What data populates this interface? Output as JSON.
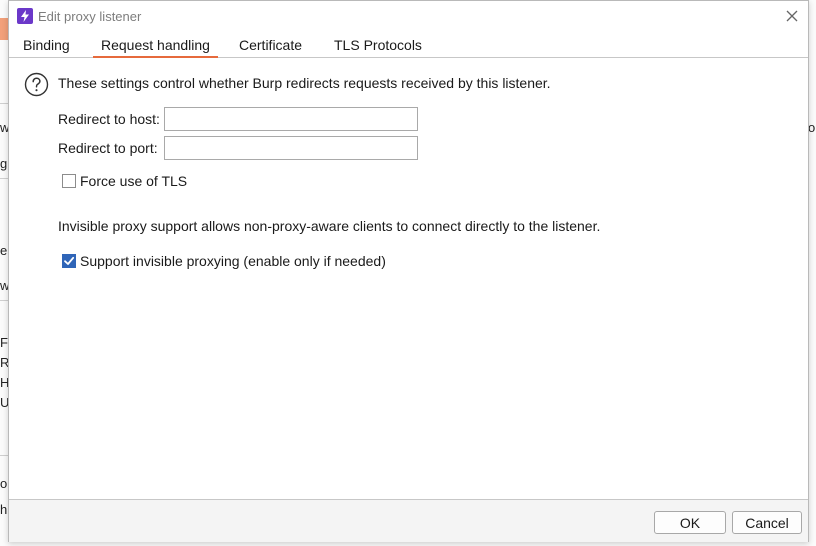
{
  "dialog": {
    "title": "Edit proxy listener",
    "tabs": [
      {
        "label": "Binding"
      },
      {
        "label": "Request handling"
      },
      {
        "label": "Certificate"
      },
      {
        "label": "TLS Protocols"
      }
    ],
    "active_tab": "Request handling",
    "redirect_description": "These settings control whether Burp redirects requests received by this listener.",
    "redirect_host": {
      "label": "Redirect to host:",
      "value": ""
    },
    "redirect_port": {
      "label": "Redirect to port:",
      "value": ""
    },
    "force_tls": {
      "label": "Force use of TLS",
      "checked": false
    },
    "invisible_description": "Invisible proxy support allows non-proxy-aware clients to connect directly to the listener.",
    "invisible_proxying": {
      "label": "Support invisible proxying (enable only if needed)",
      "checked": true
    },
    "ok_label": "OK",
    "cancel_label": "Cancel"
  },
  "background": {
    "left_fragments": [
      "w",
      "g",
      "e",
      "w",
      "Fi",
      "R",
      "H",
      "U",
      "ou",
      "h"
    ],
    "right_fragments": [
      "o"
    ]
  },
  "colors": {
    "accent_tab_underline": "#e66a3c",
    "checkbox_checked": "#2f65b8",
    "app_icon": "#6b38c9"
  },
  "icons": {
    "app": "burp-lightning-icon",
    "close": "close-icon",
    "help": "question-circle-icon",
    "check": "checkmark-icon"
  }
}
